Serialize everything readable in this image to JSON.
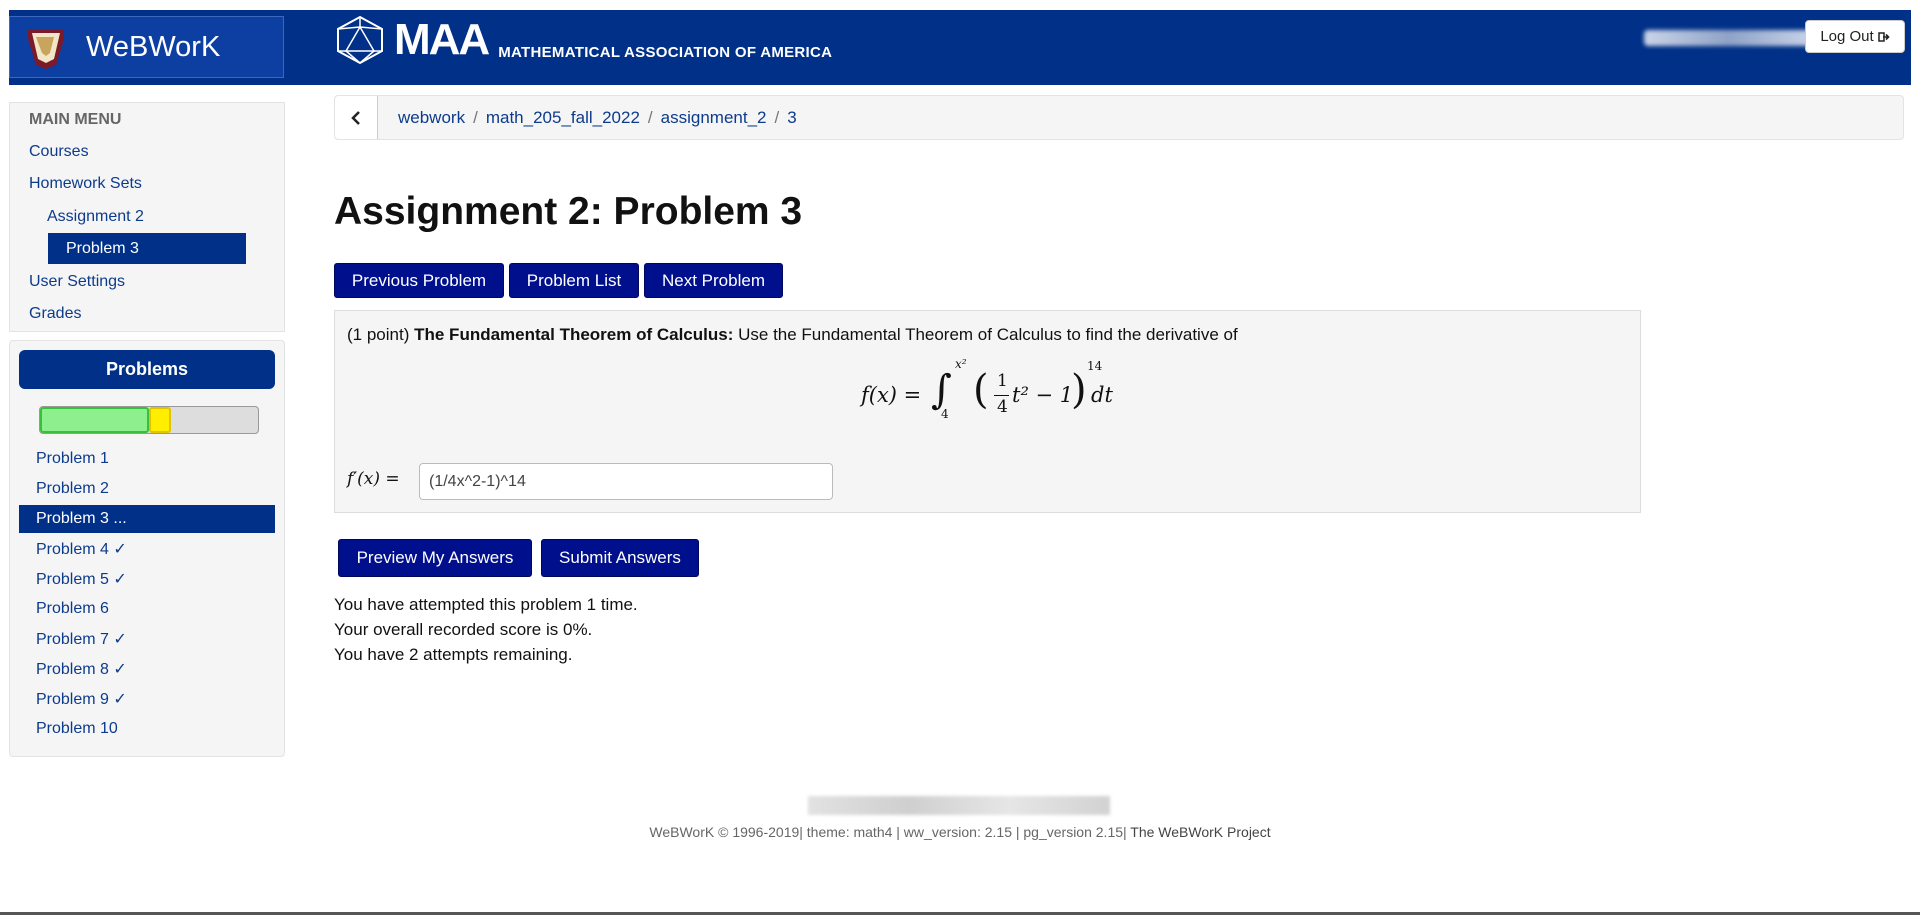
{
  "header": {
    "app_name": "WeBWorK",
    "maa_short": "MAA",
    "maa_long": "MATHEMATICAL ASSOCIATION OF AMERICA",
    "logout_label": "Log Out",
    "colors": {
      "brand": "#003087",
      "button": "#000f8c"
    }
  },
  "main_menu": {
    "heading": "MAIN MENU",
    "items": [
      {
        "label": "Courses"
      },
      {
        "label": "Homework Sets"
      },
      {
        "label": "Assignment 2"
      },
      {
        "label": "Problem 3",
        "active": true
      },
      {
        "label": "User Settings"
      },
      {
        "label": "Grades"
      }
    ]
  },
  "problems_panel": {
    "title": "Problems",
    "progress": {
      "correct_fraction": 0.5,
      "in_progress_fraction": 0.1
    },
    "items": [
      {
        "label": "Problem 1"
      },
      {
        "label": "Problem 2"
      },
      {
        "label": "Problem 3 ...",
        "active": true
      },
      {
        "label": "Problem 4 ✓"
      },
      {
        "label": "Problem 5 ✓"
      },
      {
        "label": "Problem 6"
      },
      {
        "label": "Problem 7 ✓"
      },
      {
        "label": "Problem 8 ✓"
      },
      {
        "label": "Problem 9 ✓"
      },
      {
        "label": "Problem 10"
      }
    ]
  },
  "breadcrumb": [
    "webwork",
    "math_205_fall_2022",
    "assignment_2",
    "3"
  ],
  "page_title": "Assignment 2: Problem 3",
  "nav_buttons": {
    "previous": "Previous Problem",
    "list": "Problem List",
    "next": "Next Problem"
  },
  "problem": {
    "points": "(1 point)",
    "heading": "The Fundamental Theorem of Calculus:",
    "text": "Use the Fundamental Theorem of Calculus to find the derivative of",
    "formula": {
      "lhs": "f(x) =",
      "lower_limit": "4",
      "upper_limit": "x²",
      "fraction_num": "1",
      "fraction_den": "4",
      "term": "t² − 1",
      "exponent": "14",
      "differential": "dt"
    },
    "answer_label": "f′(x) =",
    "answer_value": "(1/4x^2-1)^14"
  },
  "answer_buttons": {
    "preview": "Preview My Answers",
    "submit": "Submit Answers"
  },
  "status": [
    "You have attempted this problem 1 time.",
    "Your overall recorded score is 0%.",
    "You have 2 attempts remaining."
  ],
  "footer": {
    "text": "WeBWorK © 1996-2019| theme: math4 | ww_version: 2.15 | pg_version 2.15|",
    "link": "The WeBWorK Project"
  }
}
